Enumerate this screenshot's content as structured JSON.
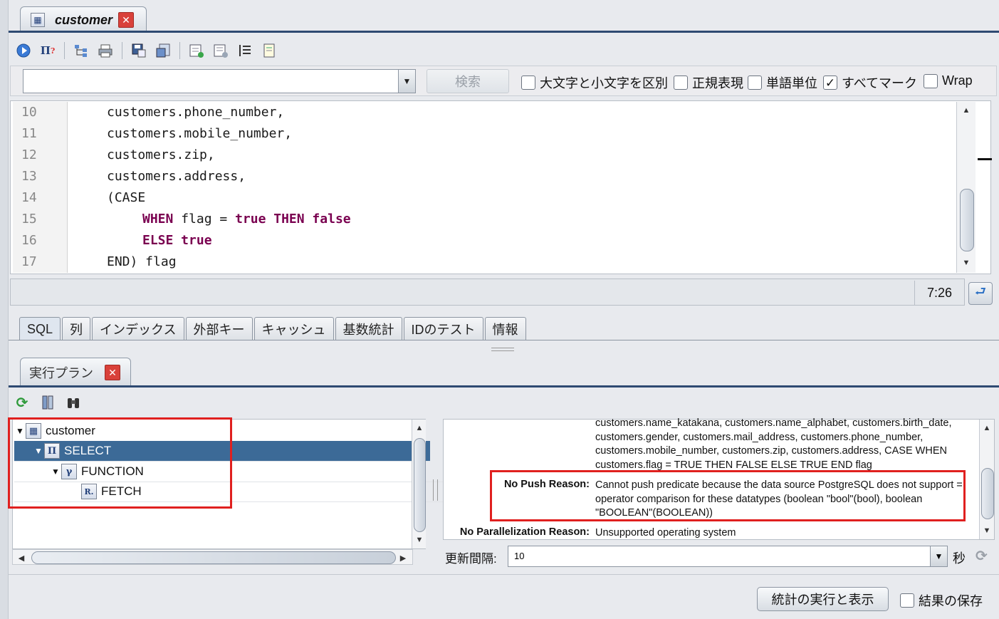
{
  "editor_tab": {
    "title": "customer",
    "close": "✕"
  },
  "search": {
    "query": "",
    "button_label": "検索"
  },
  "options": [
    {
      "label": "大文字と小文字を区別",
      "checked": false
    },
    {
      "label": "正規表現",
      "checked": false
    },
    {
      "label": "単語単位",
      "checked": false
    },
    {
      "label": "すべてマーク",
      "checked": true
    },
    {
      "label": "Wrap",
      "checked": false
    }
  ],
  "code_lines": [
    {
      "n": "10",
      "text": "customers.phone_number,"
    },
    {
      "n": "11",
      "text": "customers.mobile_number,"
    },
    {
      "n": "12",
      "text": "customers.zip,"
    },
    {
      "n": "13",
      "text": "customers.address,"
    },
    {
      "n": "14",
      "text": "(CASE"
    },
    {
      "n": "15",
      "kw1": "WHEN",
      "mid1": " flag = ",
      "kw2": "true THEN false"
    },
    {
      "n": "16",
      "kw1": "ELSE true"
    },
    {
      "n": "17",
      "text": "END) flag"
    }
  ],
  "cursor_position": "7:26",
  "sub_tabs": [
    "SQL",
    "列",
    "インデックス",
    "外部キー",
    "キャッシュ",
    "基数統計",
    "IDのテスト",
    "情報"
  ],
  "active_sub_tab": "SQL",
  "plan_tab": {
    "title": "実行プラン",
    "close": "✕"
  },
  "plan_tree": [
    {
      "label": "customer",
      "icon": "table-icon",
      "glyph": "▦",
      "expanded": true,
      "level": 0
    },
    {
      "label": "SELECT",
      "icon": "pi-icon",
      "glyph": "Π",
      "expanded": true,
      "level": 1,
      "selected": true
    },
    {
      "label": "FUNCTION",
      "icon": "gamma-icon",
      "glyph": "γ",
      "expanded": true,
      "level": 2
    },
    {
      "label": "FETCH",
      "icon": "r-icon",
      "glyph": "R.",
      "expanded": false,
      "level": 3
    }
  ],
  "details": {
    "projection_text": "customers.name_katakana, customers.name_alphabet, customers.birth_date, customers.gender, customers.mail_address, customers.phone_number, customers.mobile_number, customers.zip, customers.address, CASE WHEN customers.flag = TRUE THEN FALSE ELSE TRUE END flag",
    "no_push_label": "No Push Reason:",
    "no_push_text": "Cannot push predicate because the data source PostgreSQL does not support = operator comparison for these datatypes (boolean \"bool\"(bool), boolean \"BOOLEAN\"(BOOLEAN))",
    "no_parallel_label": "No Parallelization Reason:",
    "no_parallel_text": "Unsupported operating system"
  },
  "refresh": {
    "label": "更新間隔:",
    "value": "10",
    "unit": "秒"
  },
  "footer": {
    "run_button": "統計の実行と表示",
    "save_label": "結果の保存",
    "save_checked": false
  },
  "colors": {
    "accent": "#2e4a72",
    "selection": "#3c6a97",
    "keyword": "#7a0050",
    "highlight": "#e0201f"
  }
}
